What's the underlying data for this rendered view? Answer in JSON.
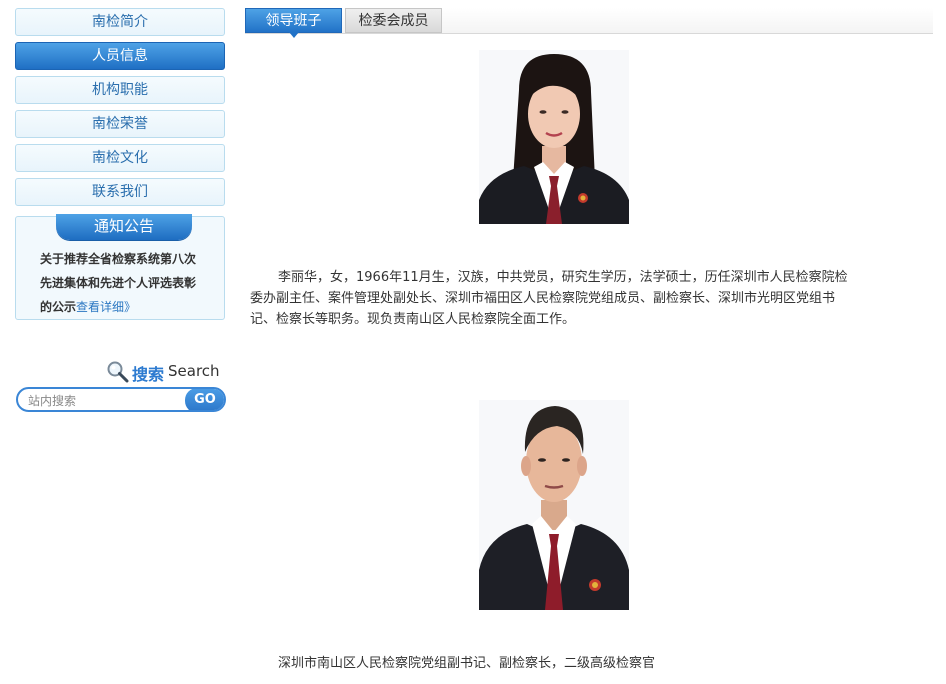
{
  "sidebar": {
    "items": [
      {
        "label": "南检简介",
        "active": false
      },
      {
        "label": "人员信息",
        "active": true
      },
      {
        "label": "机构职能",
        "active": false
      },
      {
        "label": "南检荣誉",
        "active": false
      },
      {
        "label": "南检文化",
        "active": false
      },
      {
        "label": "联系我们",
        "active": false
      }
    ],
    "notice": {
      "title": "通知公告",
      "text": "关于推荐全省检察系统第八次先进集体和先进个人评选表彰的公示",
      "more": "查看详细》"
    },
    "search": {
      "title_cn": "搜索",
      "title_en": "Search",
      "placeholder": "站内搜索",
      "button": "GO"
    }
  },
  "tabs": [
    {
      "label": "领导班子",
      "active": true
    },
    {
      "label": "检委会成员",
      "active": false
    }
  ],
  "people": [
    {
      "photo_icon": "portrait-female",
      "bio": "李丽华，女，1966年11月生，汉族，中共党员，研究生学历，法学硕士，历任深圳市人民检察院检委办副主任、案件管理处副处长、深圳市福田区人民检察院党组成员、副检察长、深圳市光明区党组书记、检察长等职务。现负责南山区人民检察院全面工作。"
    },
    {
      "photo_icon": "portrait-male",
      "bio": "深圳市南山区人民检察院党组副书记、副检察长，二级高级检察官"
    }
  ],
  "colors": {
    "accent": "#2172c7",
    "nav_border": "#b9dcee",
    "link": "#2b77c2"
  }
}
